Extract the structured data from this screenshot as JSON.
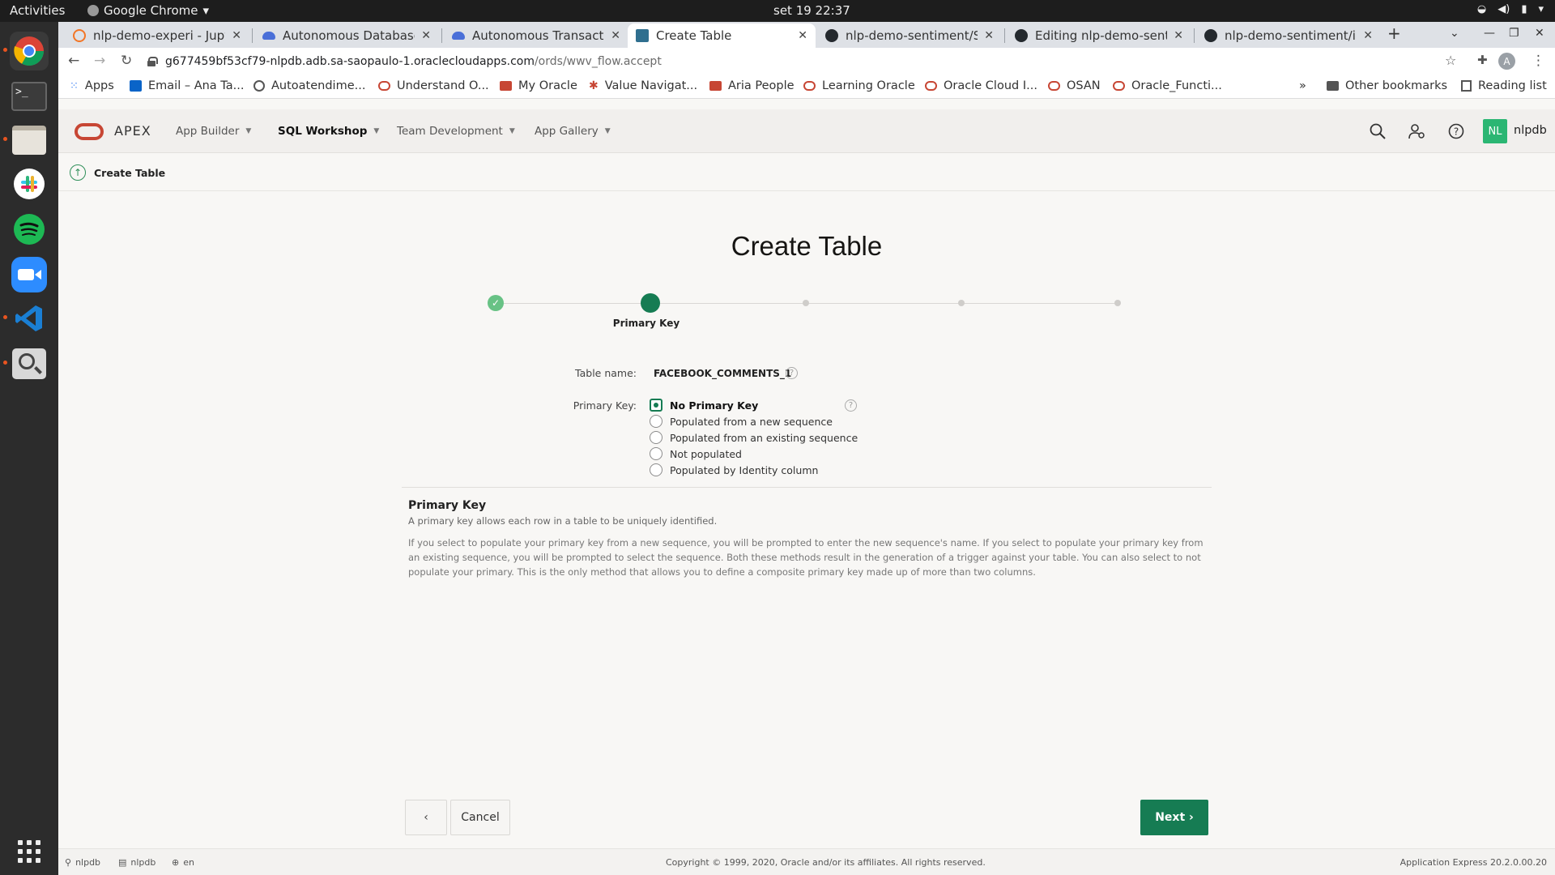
{
  "system": {
    "activities": "Activities",
    "app_name": "Google Chrome",
    "clock": "set 19  22:37"
  },
  "dock": {
    "apps": [
      "chrome",
      "terminal",
      "files",
      "slack",
      "spotify",
      "zoom",
      "vscode",
      "image-viewer",
      "show-applications"
    ]
  },
  "browser": {
    "tabs": [
      {
        "title": "nlp-demo-experi - Jupyte",
        "favicon_color": "#f37626"
      },
      {
        "title": "Autonomous Database",
        "favicon_color": "#4a6fd8"
      },
      {
        "title": "Autonomous Transactio",
        "favicon_color": "#4a6fd8"
      },
      {
        "title": "Create Table",
        "favicon_color": "#2f6f8f"
      },
      {
        "title": "nlp-demo-sentiment/Scr",
        "favicon_color": "#24292e"
      },
      {
        "title": "Editing nlp-demo-sentim",
        "favicon_color": "#24292e"
      },
      {
        "title": "nlp-demo-sentiment/ima",
        "favicon_color": "#24292e"
      }
    ],
    "url_host": "g677459bf53cf79-nlpdb.adb.sa-saopaulo-1.oraclecloudapps.com",
    "url_path": "/ords/wwv_flow.accept",
    "bookmarks": [
      "Apps",
      "Email – Ana Ta...",
      "Autoatendime...",
      "Understand O...",
      "My Oracle",
      "Value Navigat...",
      "Aria People",
      "Learning Oracle",
      "Oracle Cloud I...",
      "OSAN",
      "Oracle_Functi..."
    ],
    "other_bookmarks": "Other bookmarks",
    "reading_list": "Reading list",
    "overflow": "»",
    "profile_initial": "A"
  },
  "apex": {
    "logo_text": "APEX",
    "menus": [
      "App Builder",
      "SQL Workshop",
      "Team Development",
      "App Gallery"
    ],
    "user_initials": "NL",
    "user_name": "nlpdb",
    "breadcrumb": "Create Table",
    "page_title": "Create Table",
    "wizard": {
      "current_step_label": "Primary Key",
      "total_steps": 5,
      "current_step": 2
    },
    "form": {
      "table_name_label": "Table name:",
      "table_name_value": "FACEBOOK_COMMENTS_1",
      "primary_key_label": "Primary Key:",
      "options": [
        "No Primary Key",
        "Populated from a new sequence",
        "Populated from an existing sequence",
        "Not populated",
        "Populated by Identity column"
      ],
      "selected_option": "No Primary Key",
      "help_glyph": "?"
    },
    "help": {
      "title": "Primary Key",
      "subtitle": "A primary key allows each row in a table to be uniquely identified.",
      "body": "If you select to populate your primary key from a new sequence, you will be prompted to enter the new sequence's name. If you select to populate your primary key from an existing sequence, you will be prompted to select the sequence. Both these methods result in the generation of a trigger against your table. You can also select to not populate your primary. This is the only method that allows you to define a composite primary key made up of more than two columns."
    },
    "buttons": {
      "back": "‹",
      "cancel": "Cancel",
      "next": "Next ›"
    },
    "footer": {
      "user": "nlpdb",
      "schema": "nlpdb",
      "language": "en",
      "copyright": "Copyright © 1999, 2020, Oracle and/or its affiliates. All rights reserved.",
      "version": "Application Express 20.2.0.00.20"
    },
    "colors": {
      "accent": "#167c53",
      "brand": "#c74634"
    }
  }
}
